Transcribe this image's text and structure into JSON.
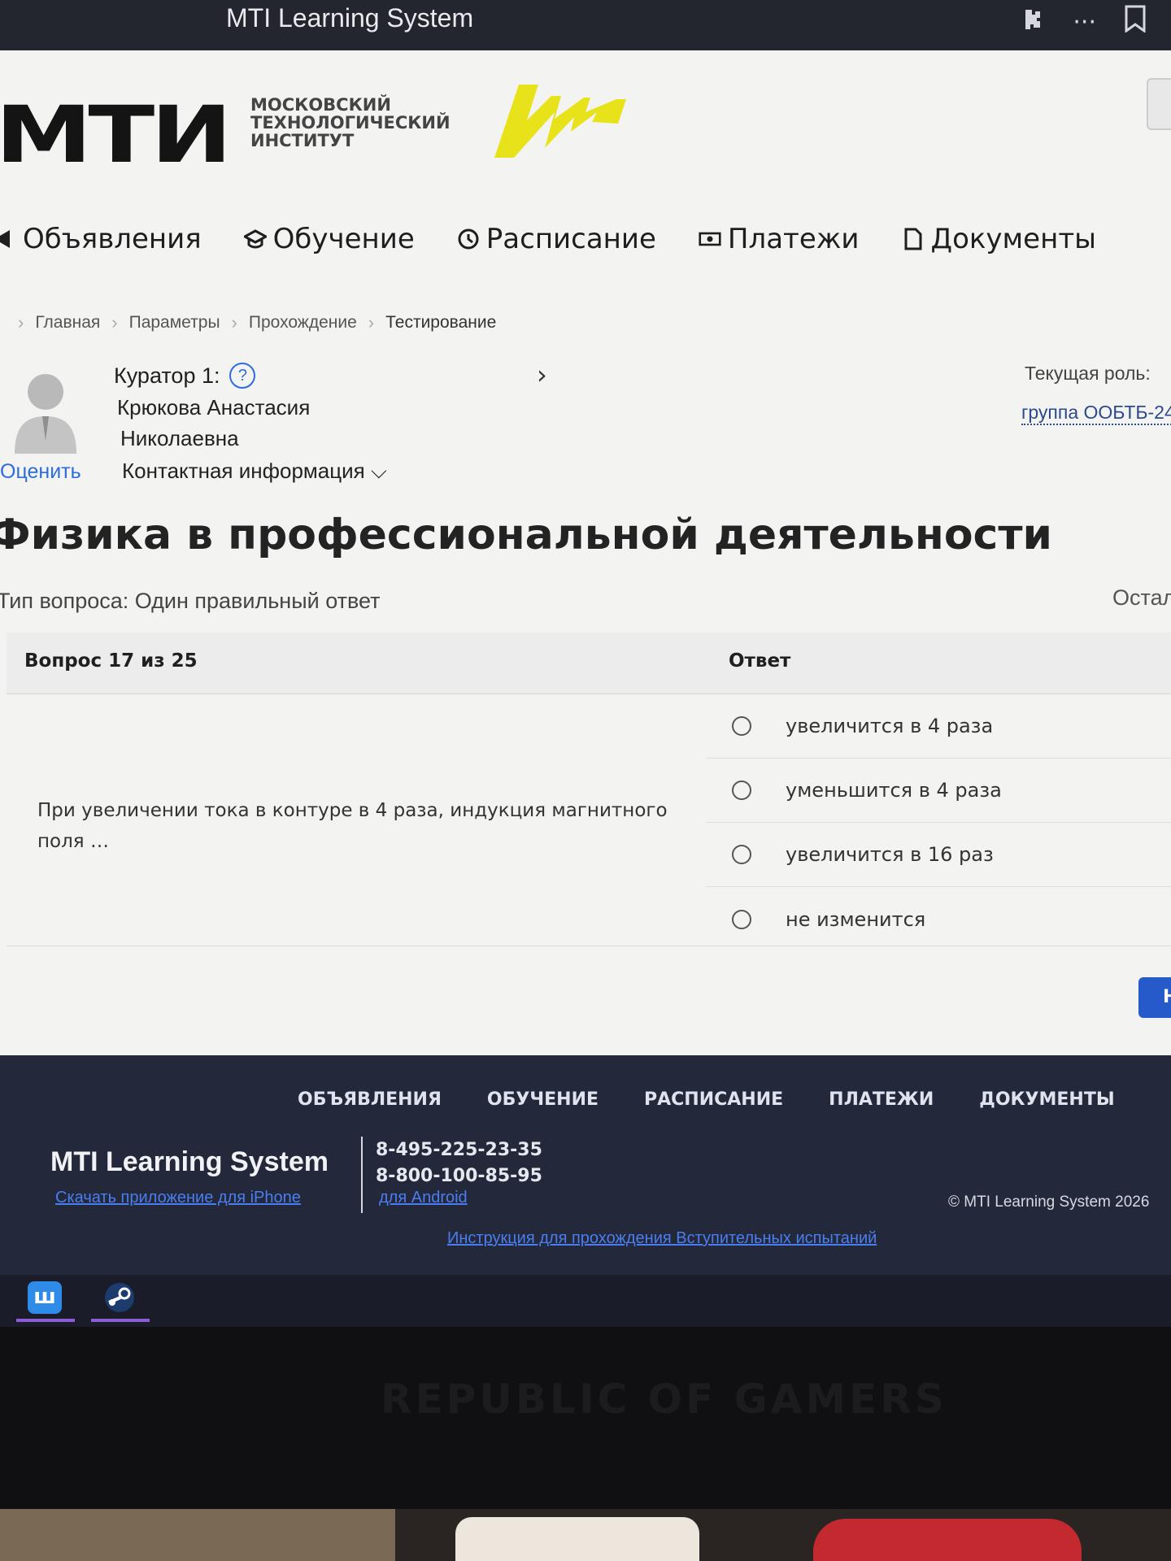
{
  "browser": {
    "title": "MTI Learning System",
    "icons": [
      "extensions-icon",
      "more-icon",
      "bookmark-icon"
    ],
    "more_glyph": "···"
  },
  "header": {
    "logo_mark": "МТИ",
    "logo_lines": [
      "Московский",
      "технологический",
      "институт"
    ],
    "brand_yellow": "#e7e21a"
  },
  "nav": [
    {
      "label": "Объявления",
      "icon": "megaphone-icon"
    },
    {
      "label": "Обучение",
      "icon": "graduation-cap-icon"
    },
    {
      "label": "Расписание",
      "icon": "clock-icon"
    },
    {
      "label": "Платежи",
      "icon": "money-icon"
    },
    {
      "label": "Документы",
      "icon": "document-icon"
    }
  ],
  "breadcrumb": [
    "Главная",
    "Параметры",
    "Прохождение",
    "Тестирование"
  ],
  "curator": {
    "label": "Куратор 1:",
    "help_glyph": "?",
    "name_line1": "Крюкова Анастасия",
    "name_line2": "Николаевна",
    "contact_info": "Контактная информация ⌵",
    "rate_link": "Оценить",
    "chevron": "›"
  },
  "role": {
    "label": "Текущая роль:",
    "value": "группа ООБТБ-24"
  },
  "course": {
    "title": "Физика в профессиональной деятельности",
    "question_type": "Тип вопроса: Один правильный ответ",
    "remaining": "Остал"
  },
  "question": {
    "header_left": "Вопрос 17 из 25",
    "header_right": "Ответ",
    "text": "При увеличении тока в контуре в 4 раза, индукция магнитного поля …",
    "answers": [
      {
        "label": "увеличится в 4 раза",
        "selected": false
      },
      {
        "label": "уменьшится в 4 раза",
        "selected": false
      },
      {
        "label": "увеличится в 16 раз",
        "selected": false
      },
      {
        "label": "не изменится",
        "selected": false
      }
    ],
    "next_button": "Н"
  },
  "footer": {
    "nav": [
      "ОБЪЯВЛЕНИЯ",
      "ОБУЧЕНИЕ",
      "РАСПИСАНИЕ",
      "ПЛАТЕЖИ",
      "ДОКУМЕНТЫ"
    ],
    "brand": "MTI Learning System",
    "iphone_link": "Скачать приложение для iPhone",
    "phone1": "8-495-225-23-35",
    "phone2": "8-800-100-85-95",
    "android_link": "для Android",
    "copyright": "© MTI Learning System 2026",
    "guide_link": "Инструкция для прохождения Вступительных испытаний"
  },
  "taskbar": {
    "apps": [
      {
        "icon": "wallpaper-app-icon",
        "glyph": "ш",
        "color": "#2f8be8"
      },
      {
        "icon": "steam-icon",
        "glyph": "",
        "color": "#1d3c6e"
      }
    ]
  },
  "bezel": {
    "text": "REPUBLIC OF GAMERS"
  }
}
